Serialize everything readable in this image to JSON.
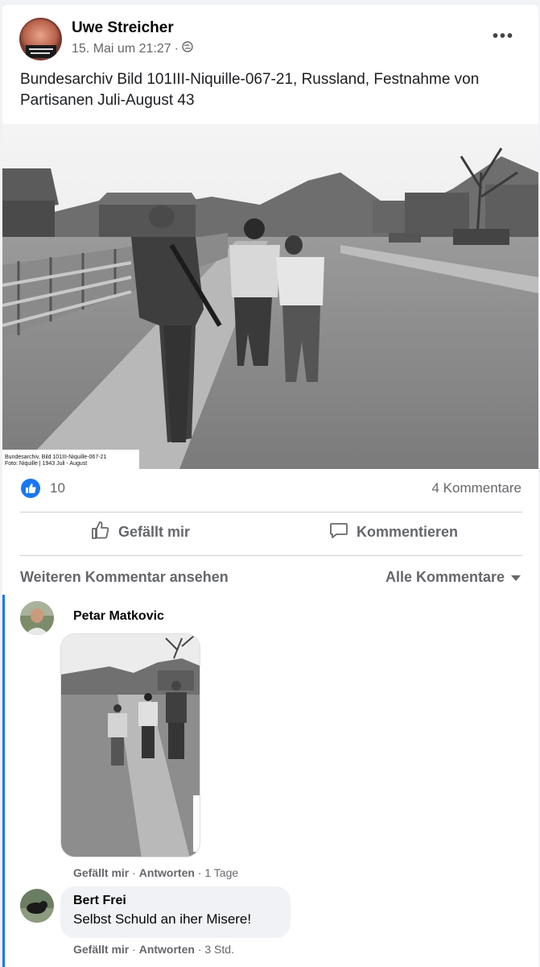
{
  "post": {
    "author": "Uwe Streicher",
    "date": "15. Mai um 21:27",
    "separator": "·",
    "text": "Bundesarchiv Bild 101III-Niquille-067-21, Russland, Festnahme von Partisanen   Juli-August 43",
    "photo_credit": "Bundesarchiv, Bild 101III-Niquille-067-21\nFoto: Niquille | 1943 Juli - August"
  },
  "reactions": {
    "like_count": "10",
    "comment_count": "4 Kommentare"
  },
  "actions": {
    "like": "Gefällt mir",
    "comment": "Kommentieren"
  },
  "comments_header": {
    "more": "Weiteren Kommentar ansehen",
    "filter": "Alle Kommentare"
  },
  "comments": [
    {
      "author": "Petar Matkovic",
      "like": "Gefällt mir",
      "reply": "Antworten",
      "time": "1 Tage",
      "sep": "·"
    },
    {
      "author": "Bert Frei",
      "text": "Selbst Schuld an iher Misere!",
      "like": "Gefällt mir",
      "reply": "Antworten",
      "time": "3 Std.",
      "sep": "·"
    }
  ],
  "colors": {
    "accent": "#1877f2",
    "secondary_text": "#65676b"
  },
  "icons": [
    "globe-icon",
    "more-icon",
    "like-badge-icon",
    "thumbs-up-icon",
    "comment-icon",
    "caret-down-icon"
  ]
}
